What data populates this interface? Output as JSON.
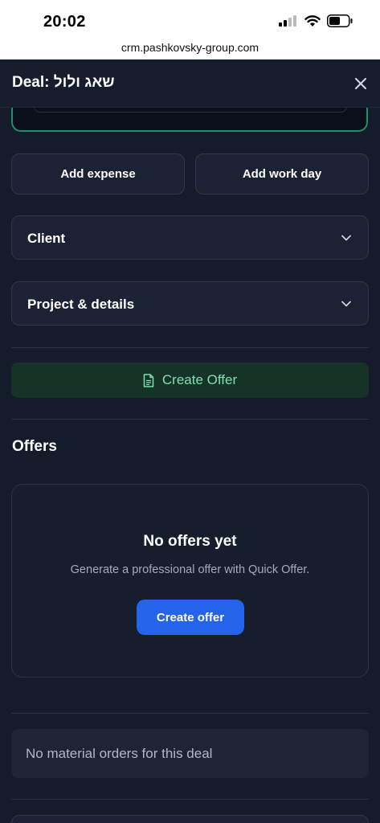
{
  "status_bar": {
    "time": "20:02"
  },
  "browser": {
    "url": "crm.pashkovsky-group.com"
  },
  "header": {
    "title": "Deal: שאג ולול"
  },
  "actions": {
    "add_expense": "Add expense",
    "add_work_day": "Add work day"
  },
  "sections": {
    "client": "Client",
    "project": "Project & details"
  },
  "create_offer_bar": {
    "label": "Create Offer"
  },
  "offers": {
    "title": "Offers",
    "empty_title": "No offers yet",
    "empty_subtitle": "Generate a professional offer with Quick Offer.",
    "create_button": "Create offer"
  },
  "materials": {
    "empty_text": "No material orders for this deal"
  },
  "colors": {
    "background": "#141b2b",
    "accent_green": "#7ce0b1",
    "primary_blue": "#2563eb"
  }
}
